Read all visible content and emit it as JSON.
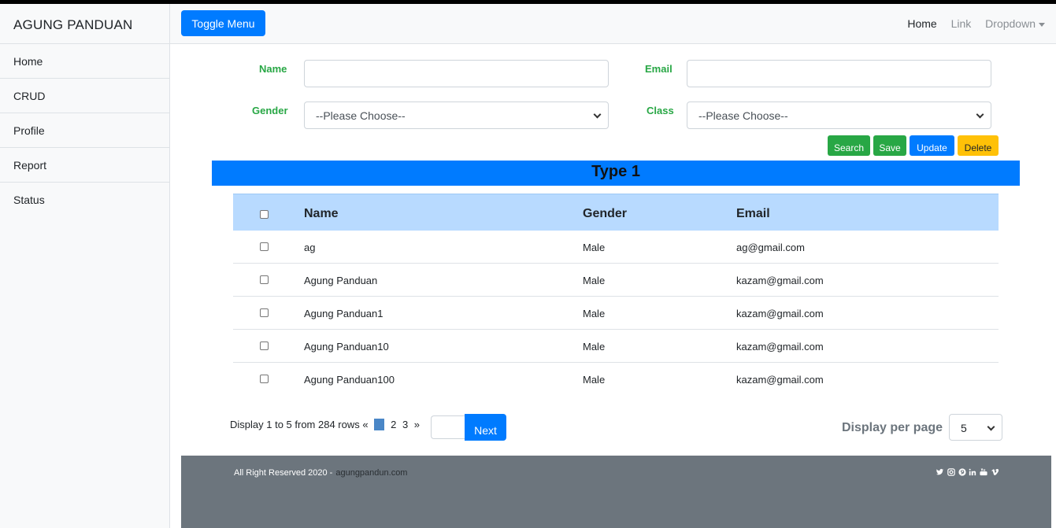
{
  "sidebar": {
    "brand": "AGUNG PANDUAN",
    "items": [
      {
        "label": "Home"
      },
      {
        "label": "CRUD"
      },
      {
        "label": "Profile"
      },
      {
        "label": "Report"
      },
      {
        "label": "Status"
      }
    ]
  },
  "navbar": {
    "toggle_label": "Toggle Menu",
    "links": {
      "home": "Home",
      "link": "Link",
      "dropdown": "Dropdown"
    }
  },
  "form": {
    "name_label": "Name",
    "name_value": "",
    "email_label": "Email",
    "email_value": "",
    "gender_label": "Gender",
    "gender_selected": "--Please Choose--",
    "class_label": "Class",
    "class_selected": "--Please Choose--"
  },
  "actions": {
    "search": "Search",
    "save": "Save",
    "update": "Update",
    "delete": "Delete"
  },
  "type_title": "Type 1",
  "table": {
    "headers": {
      "name": "Name",
      "gender": "Gender",
      "email": "Email"
    },
    "rows": [
      {
        "name": "ag",
        "gender": "Male",
        "email": "ag@gmail.com"
      },
      {
        "name": "Agung Panduan",
        "gender": "Male",
        "email": "kazam@gmail.com"
      },
      {
        "name": "Agung Panduan1",
        "gender": "Male",
        "email": "kazam@gmail.com"
      },
      {
        "name": "Agung Panduan10",
        "gender": "Male",
        "email": "kazam@gmail.com"
      },
      {
        "name": "Agung Panduan100",
        "gender": "Male",
        "email": "kazam@gmail.com"
      }
    ]
  },
  "pagination": {
    "info": "Display 1 to 5 from 284 rows",
    "prev": "«",
    "pages": [
      "1",
      "2",
      "3"
    ],
    "active_page": "1",
    "next_symbol": "»",
    "page_input_value": "",
    "next_label": "Next",
    "per_page_label": "Display per page",
    "per_page_value": "5"
  },
  "footer": {
    "text": "All Right Reserved 2020 -",
    "link": "agungpandun.com",
    "social_icons": [
      "twitter-icon",
      "instagram-icon",
      "pinterest-icon",
      "linkedin-icon",
      "youtube-icon",
      "vimeo-icon"
    ]
  },
  "colors": {
    "primary": "#007bff",
    "success": "#28a745",
    "warning": "#ffc107",
    "table_head": "#b8daff",
    "footer": "#6c757d"
  }
}
